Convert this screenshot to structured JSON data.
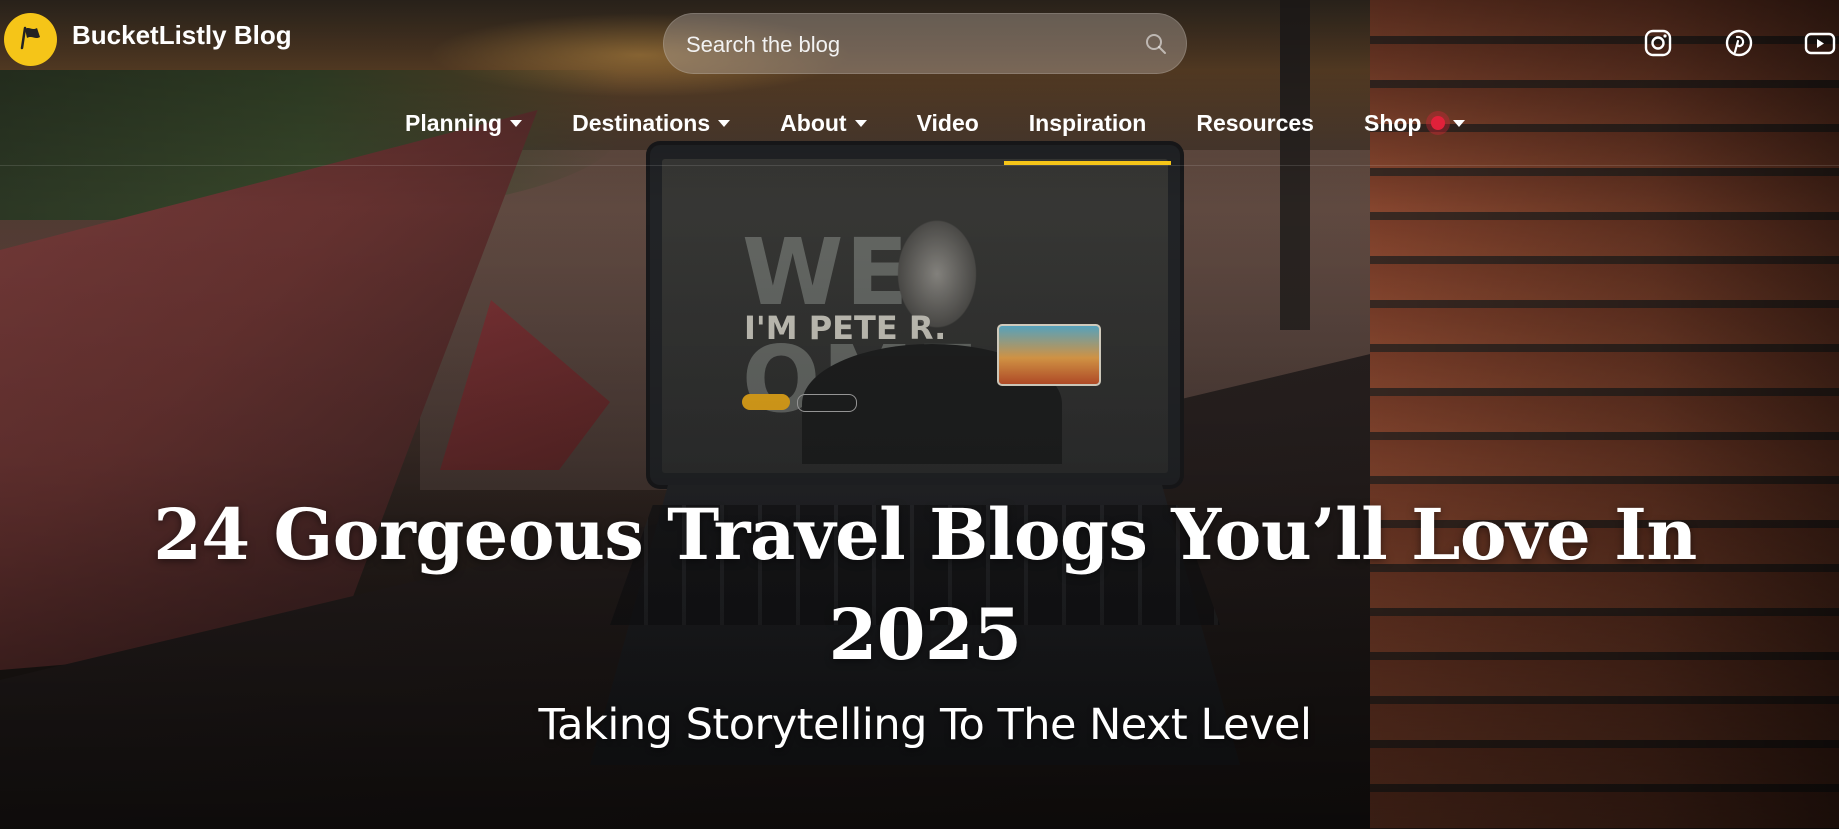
{
  "header": {
    "brand_name": "BucketListly Blog",
    "logo_icon": "flag-icon",
    "brand_color": "#f5c518"
  },
  "search": {
    "placeholder": "Search the blog",
    "icon": "search-icon"
  },
  "social": [
    {
      "name": "instagram-icon"
    },
    {
      "name": "pinterest-icon"
    },
    {
      "name": "youtube-icon"
    }
  ],
  "nav": {
    "items": [
      {
        "label": "Planning",
        "has_dropdown": true
      },
      {
        "label": "Destinations",
        "has_dropdown": true
      },
      {
        "label": "About",
        "has_dropdown": true
      },
      {
        "label": "Video",
        "has_dropdown": false
      },
      {
        "label": "Inspiration",
        "has_dropdown": false,
        "active": true
      },
      {
        "label": "Resources",
        "has_dropdown": false
      },
      {
        "label": "Shop",
        "has_dropdown": true,
        "badge": "dot"
      }
    ],
    "active_indicator_color": "#f5c518",
    "badge_color": "#e0213a"
  },
  "hero": {
    "title": "24 Gorgeous Travel Blogs You’ll Love In 2025",
    "subtitle": "Taking Storytelling To The Next Level"
  }
}
